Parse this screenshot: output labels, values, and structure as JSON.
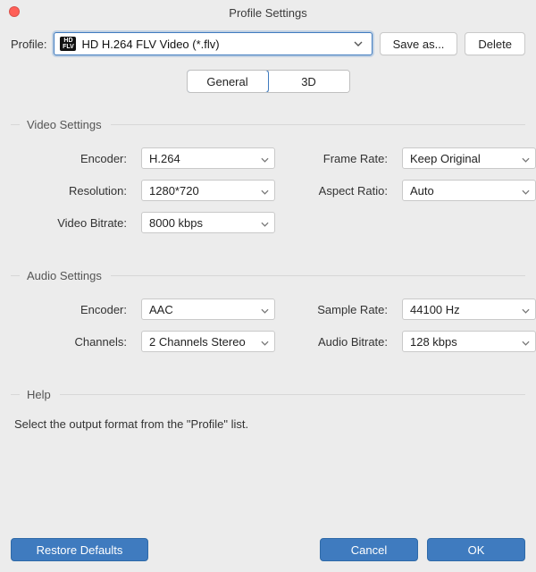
{
  "window": {
    "title": "Profile Settings"
  },
  "profile": {
    "label": "Profile:",
    "icon_text": "HD\nFLV",
    "value": "HD H.264 FLV Video (*.flv)",
    "save_as_label": "Save as...",
    "delete_label": "Delete"
  },
  "tabs": {
    "general": "General",
    "threeD": "3D"
  },
  "video": {
    "section_title": "Video Settings",
    "encoder_label": "Encoder:",
    "encoder_value": "H.264",
    "resolution_label": "Resolution:",
    "resolution_value": "1280*720",
    "bitrate_label": "Video Bitrate:",
    "bitrate_value": "8000 kbps",
    "framerate_label": "Frame Rate:",
    "framerate_value": "Keep Original",
    "aspect_label": "Aspect Ratio:",
    "aspect_value": "Auto"
  },
  "audio": {
    "section_title": "Audio Settings",
    "encoder_label": "Encoder:",
    "encoder_value": "AAC",
    "channels_label": "Channels:",
    "channels_value": "2 Channels Stereo",
    "samplerate_label": "Sample Rate:",
    "samplerate_value": "44100 Hz",
    "bitrate_label": "Audio Bitrate:",
    "bitrate_value": "128 kbps"
  },
  "help": {
    "section_title": "Help",
    "text": "Select the output format from the \"Profile\" list."
  },
  "footer": {
    "restore_label": "Restore Defaults",
    "cancel_label": "Cancel",
    "ok_label": "OK"
  }
}
